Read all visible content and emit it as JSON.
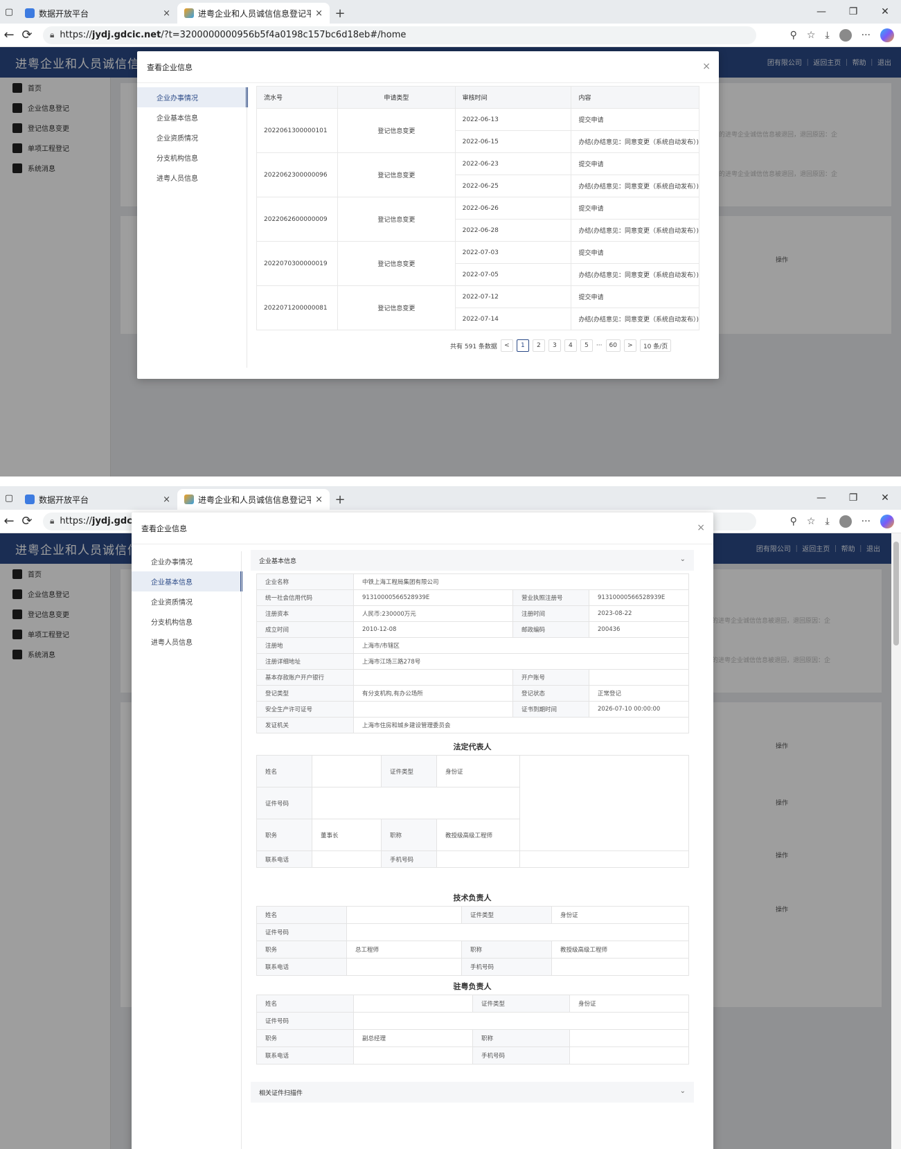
{
  "browser": {
    "tab1_title": "数据开放平台",
    "tab2_title": "进粤企业和人员诚信信息登记平台",
    "url_scheme": "https://",
    "url_host": "jydj.gdcic.net",
    "url_path": "/?t=3200000000956b5f4a0198c157bc6d18eb#/home",
    "icons": {
      "lock": "🔒︎",
      "back": "←",
      "refresh": "⟳",
      "zoom": "⚲",
      "star": "☆",
      "download": "⤓",
      "more": "···"
    }
  },
  "app": {
    "title": "进粤企业和人员诚信信息登记",
    "header_links": "团有限公司 ｜ 返回主页 ｜ 帮助 ｜ 退出",
    "sidebar": [
      {
        "label": "首页",
        "icon": "home-icon"
      },
      {
        "label": "企业信息登记",
        "icon": "building-icon"
      },
      {
        "label": "登记信息变更",
        "icon": "edit-icon"
      },
      {
        "label": "单项工程登记",
        "icon": "clipboard-icon"
      },
      {
        "label": "系统消息",
        "icon": "message-icon"
      }
    ],
    "bg_notice": "的进粤企业诚信信息被退回，退回原因：企",
    "bg_op": "操作"
  },
  "modal": {
    "title": "查看企业信息",
    "nav": [
      "企业办事情况",
      "企业基本信息",
      "企业资质情况",
      "分支机构信息",
      "进粤人员信息"
    ],
    "close": "×"
  },
  "records": {
    "columns": [
      "流水号",
      "申请类型",
      "审核时间",
      "内容"
    ],
    "rows": [
      {
        "no": "2022061300000101",
        "type": "登记信息变更",
        "events": [
          {
            "time": "2022-06-13",
            "content": "提交申请"
          },
          {
            "time": "2022-06-15",
            "content": "办结(办结意见：同意变更（系统自动发布）)"
          }
        ]
      },
      {
        "no": "2022062300000096",
        "type": "登记信息变更",
        "events": [
          {
            "time": "2022-06-23",
            "content": "提交申请"
          },
          {
            "time": "2022-06-25",
            "content": "办结(办结意见：同意变更（系统自动发布）)"
          }
        ]
      },
      {
        "no": "2022062600000009",
        "type": "登记信息变更",
        "events": [
          {
            "time": "2022-06-26",
            "content": "提交申请"
          },
          {
            "time": "2022-06-28",
            "content": "办结(办结意见：同意变更（系统自动发布）)"
          }
        ]
      },
      {
        "no": "2022070300000019",
        "type": "登记信息变更",
        "events": [
          {
            "time": "2022-07-03",
            "content": "提交申请"
          },
          {
            "time": "2022-07-05",
            "content": "办结(办结意见：同意变更（系统自动发布）)"
          }
        ]
      },
      {
        "no": "2022071200000081",
        "type": "登记信息变更",
        "events": [
          {
            "time": "2022-07-12",
            "content": "提交申请"
          },
          {
            "time": "2022-07-14",
            "content": "办结(办结意见：同意变更（系统自动发布）)"
          }
        ]
      }
    ],
    "pager": {
      "total": "共有 591 条数据",
      "pages": [
        "1",
        "2",
        "3",
        "4",
        "5",
        "···",
        "60"
      ],
      "prev": "<",
      "next": ">",
      "size": "10 条/页"
    }
  },
  "basic": {
    "section_title": "企业基本信息",
    "company_name_label": "企业名称",
    "company_name": "中铁上海工程局集团有限公司",
    "credit_code_label": "统一社会信用代码",
    "credit_code": "91310000566528939E",
    "license_label": "营业执照注册号",
    "license": "91310000566528939E",
    "capital_label": "注册资本",
    "capital": "人民币:230000万元",
    "reg_time_label": "注册时间",
    "reg_time": "2023-08-22",
    "founded_label": "成立时间",
    "founded": "2010-12-08",
    "postcode_label": "邮政编码",
    "postcode": "200436",
    "reg_place_label": "注册地",
    "reg_place": "上海市/市辖区",
    "address_label": "注册详细地址",
    "address": "上海市江场三路278号",
    "bank_label": "基本存款账户开户银行",
    "bank": "",
    "account_label": "开户账号",
    "account": "",
    "reg_type_label": "登记类型",
    "reg_type": "有分支机构,有办公场所",
    "reg_status_label": "登记状态",
    "reg_status": "正常登记",
    "safety_label": "安全生产许可证号",
    "safety": "",
    "cert_expire_label": "证书到期时间",
    "cert_expire": "2026-07-10 00:00:00",
    "issuer_label": "发证机关",
    "issuer": "上海市住房和城乡建设管理委员会"
  },
  "legal": {
    "title": "法定代表人",
    "name_label": "姓名",
    "idtype_label": "证件类型",
    "idtype": "身份证",
    "idno_label": "证件号码",
    "post_label": "职务",
    "post": "董事长",
    "rank_label": "职称",
    "rank": "教授级高级工程师",
    "phone_label": "联系电话",
    "mobile_label": "手机号码"
  },
  "tech": {
    "title": "技术负责人",
    "name_label": "姓名",
    "idtype_label": "证件类型",
    "idtype": "身份证",
    "idno_label": "证件号码",
    "post_label": "职务",
    "post": "总工程师",
    "rank_label": "职称",
    "rank": "教授级高级工程师",
    "phone_label": "联系电话",
    "mobile_label": "手机号码"
  },
  "resident": {
    "title": "驻粤负责人",
    "name_label": "姓名",
    "idtype_label": "证件类型",
    "idtype": "身份证",
    "idno_label": "证件号码",
    "post_label": "职务",
    "post": "副总经理",
    "rank_label": "职称",
    "rank": "",
    "phone_label": "联系电话",
    "mobile_label": "手机号码"
  },
  "scan_section": "相关证件扫描件",
  "colors": {
    "header": "#2b4a87",
    "accent": "#2b4a87",
    "mask": "rgba(0,0,0,0.38)"
  }
}
